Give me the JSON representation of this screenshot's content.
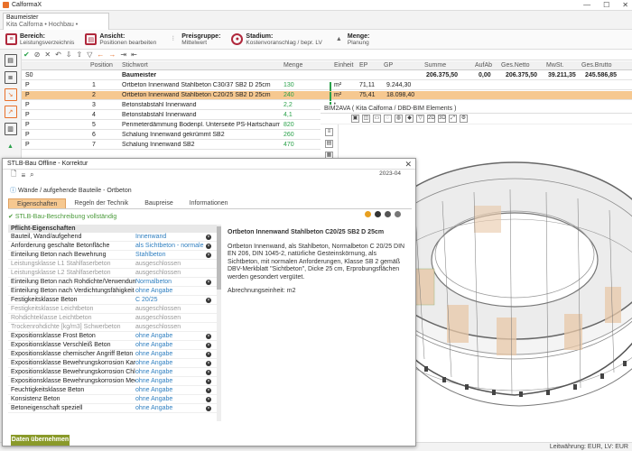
{
  "app": {
    "title": "CalformaX",
    "window_buttons": [
      "—",
      "☐",
      "✕"
    ]
  },
  "doc_tab": {
    "title": "Baumeister",
    "subtitle": "Kita Calforna • Hochbau •"
  },
  "ribbon": [
    {
      "label": "Bereich:",
      "value": "Leistungsverzeichnis"
    },
    {
      "label": "Ansicht:",
      "value": "Positionen bearbeiten"
    },
    {
      "label": "Preisgruppe:",
      "value": "Mittelwert"
    },
    {
      "label": "Stadium:",
      "value": "Kostenvoranschlag / bepr. LV"
    },
    {
      "label": "Menge:",
      "value": "Planung"
    }
  ],
  "grid": {
    "headers": [
      "Position",
      "Stichwort",
      "Menge",
      "Einheit",
      "EP",
      "GP",
      "Summe",
      "AufAb",
      "Ges.Netto",
      "MwSt.",
      "Ges.Brutto"
    ],
    "group_row": {
      "flag": "S0",
      "label": "Baumeister",
      "summe": "206.375,50",
      "aufab": "0,00",
      "netto": "206.375,50",
      "mwst": "39.211,35",
      "brutto": "245.586,85"
    },
    "rows": [
      {
        "flag": "P",
        "pos": "1",
        "text": "Ortbeton Innenwand Stahlbeton C30/37 SB2 D 25cm",
        "qty": "130",
        "unit": "m²",
        "ep": "71,11",
        "gp": "9.244,30",
        "selected": false
      },
      {
        "flag": "P",
        "pos": "2",
        "text": "Ortbeton Innenwand Stahlbeton C20/25 SB2 D 25cm",
        "qty": "240",
        "unit": "m²",
        "ep": "75,41",
        "gp": "18.098,40",
        "selected": true
      },
      {
        "flag": "P",
        "pos": "3",
        "text": "Betonstabstahl Innenwand",
        "qty": "2,2",
        "unit": "t",
        "ep": "",
        "gp": "",
        "selected": false
      },
      {
        "flag": "P",
        "pos": "4",
        "text": "Betonstabstahl Innenwand",
        "qty": "4,1",
        "unit": "t",
        "ep": "",
        "gp": "",
        "selected": false
      },
      {
        "flag": "P",
        "pos": "5",
        "text": "Perimeterdämmung Bodenpl. Unterseite PS-Hartschaum EPS D 14...",
        "qty": "820",
        "unit": "m²",
        "ep": "",
        "gp": "",
        "selected": false
      },
      {
        "flag": "P",
        "pos": "6",
        "text": "Schalung Innenwand gekrümmt SB2",
        "qty": "260",
        "unit": "m²",
        "ep": "",
        "gp": "",
        "selected": false
      },
      {
        "flag": "P",
        "pos": "7",
        "text": "Schalung Innenwand SB2",
        "qty": "470",
        "unit": "m²",
        "ep": "",
        "gp": "",
        "selected": false
      }
    ]
  },
  "bim": {
    "header": "BIM2AVA ( Kita Calforna /  DBD-BIM Elements )"
  },
  "dialog": {
    "title": "STLB-Bau Offline - Korrektur",
    "date": "2023-04",
    "breadcrumb": "Wände / aufgehende Bauteile - Ortbeton",
    "tabs": [
      "Eigenschaften",
      "Regeln der Technik",
      "Baupreise",
      "Informationen"
    ],
    "status": "STLB-Bau-Beschreibung vollständig",
    "section": "Pflicht-Eigenschaften",
    "props": [
      {
        "label": "Bauteil, Wand/aufgehend",
        "value": "Innenwand",
        "kind": "link",
        "x": true
      },
      {
        "label": "Anforderung geschalte Betonfläche",
        "value": "als Sichtbeton - normale ...",
        "kind": "link",
        "x": true
      },
      {
        "label": "Einteilung Beton nach Bewehrung",
        "value": "Stahlbeton",
        "kind": "link",
        "x": true
      },
      {
        "label": "Leistungsklasse L1 Stahlfaserbeton",
        "value": "ausgeschlossen",
        "kind": "grey",
        "x": false
      },
      {
        "label": "Leistungsklasse L2 Stahlfaserbeton",
        "value": "ausgeschlossen",
        "kind": "grey",
        "x": false
      },
      {
        "label": "Einteilung Beton nach Rohdichte/Verwendung",
        "value": "Normalbeton",
        "kind": "link",
        "x": true
      },
      {
        "label": "Einteilung Beton nach Verdichtungsfähigkeit",
        "value": "ohne Angabe",
        "kind": "link",
        "x": false
      },
      {
        "label": "Festigkeitsklasse Beton",
        "value": "C 20/25",
        "kind": "link",
        "x": true
      },
      {
        "label": "Festigkeitsklasse Leichtbeton",
        "value": "ausgeschlossen",
        "kind": "grey",
        "x": false
      },
      {
        "label": "Rohdichteklasse Leichtbeton",
        "value": "ausgeschlossen",
        "kind": "grey",
        "x": false
      },
      {
        "label": "Trockenrohdichte [kg/m3] Schwerbeton",
        "value": "ausgeschlossen",
        "kind": "grey",
        "x": false
      },
      {
        "label": "Expositionsklasse Frost Beton",
        "value": "ohne Angabe",
        "kind": "link",
        "x": true
      },
      {
        "label": "Expositionsklasse Verschleiß Beton",
        "value": "ohne Angabe",
        "kind": "link",
        "x": true
      },
      {
        "label": "Expositionsklasse chemischer Angriff Beton",
        "value": "ohne Angabe",
        "kind": "link",
        "x": true
      },
      {
        "label": "Expositionsklasse Bewehrungskorrosion Karbonati...",
        "value": "ohne Angabe",
        "kind": "link",
        "x": true
      },
      {
        "label": "Expositionsklasse Bewehrungskorrosion Chloride",
        "value": "ohne Angabe",
        "kind": "link",
        "x": true
      },
      {
        "label": "Expositionsklasse Bewehrungskorrosion Meerwasser",
        "value": "ohne Angabe",
        "kind": "link",
        "x": true
      },
      {
        "label": "Feuchtigkeitsklasse Beton",
        "value": "ohne Angabe",
        "kind": "link",
        "x": true
      },
      {
        "label": "Konsistenz Beton",
        "value": "ohne Angabe",
        "kind": "link",
        "x": true
      },
      {
        "label": "Betoneigenschaft speziell",
        "value": "ohne Angabe",
        "kind": "link",
        "x": true
      }
    ],
    "desc_title": "Ortbeton Innenwand Stahlbeton C20/25 SB2 D 25cm",
    "desc_body": "Ortbeton Innenwand, als Stahlbeton, Normalbeton C 20/25 DIN EN 206, DIN 1045-2, natürliche Gesteinskörnung, als Sichtbeton, mit normalen Anforderungen, Klasse SB 2 gemäß DBV-Merkblatt \"Sichtbeton\", Dicke 25 cm, Erprobungsflächen werden gesondert vergütet.",
    "desc_unit": "Abrechnungseinheit: m2",
    "apply_button": "Daten übernehmen"
  },
  "statusbar": {
    "text": "Leitwährung: EUR, LV: EUR"
  }
}
